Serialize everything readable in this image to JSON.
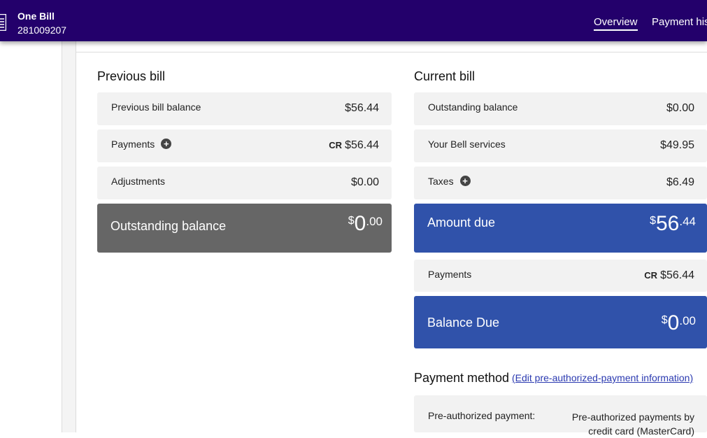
{
  "header": {
    "title": "One Bill",
    "account_number": "281009207",
    "tabs": [
      "Overview",
      "Payment his"
    ]
  },
  "previous_bill": {
    "title": "Previous bill",
    "rows": [
      {
        "label": "Previous bill balance",
        "value": "$56.44"
      },
      {
        "label": "Payments",
        "cr": "CR",
        "value": "$56.44"
      },
      {
        "label": "Adjustments",
        "value": "$0.00"
      }
    ],
    "outstanding": {
      "label": "Outstanding balance",
      "symbol": "$",
      "dollars": "0",
      "cents": ".00"
    }
  },
  "current_bill": {
    "title": "Current bill",
    "rows": [
      {
        "label": "Outstanding balance",
        "value": "$0.00"
      },
      {
        "label": "Your Bell services",
        "value": "$49.95"
      },
      {
        "label": "Taxes",
        "value": "$6.49"
      }
    ],
    "amount_due": {
      "label": "Amount due",
      "symbol": "$",
      "dollars": "56",
      "cents": ".44"
    },
    "payments": {
      "label": "Payments",
      "cr": "CR",
      "value": "$56.44"
    },
    "balance_due": {
      "label": "Balance Due",
      "symbol": "$",
      "dollars": "0",
      "cents": ".00"
    }
  },
  "payment_method": {
    "title": "Payment method",
    "edit_link": "(Edit pre-authorized-payment information)",
    "label": "Pre-authorized payment:",
    "value": "Pre-authorized payments by credit card (MasterCard)"
  },
  "colors": {
    "header": "#23006b",
    "blue_box": "#3052aa",
    "gray_box": "#666666",
    "row_bg": "#f2f2f2"
  },
  "icons": [
    "document-icon",
    "plus-circle-icon"
  ]
}
